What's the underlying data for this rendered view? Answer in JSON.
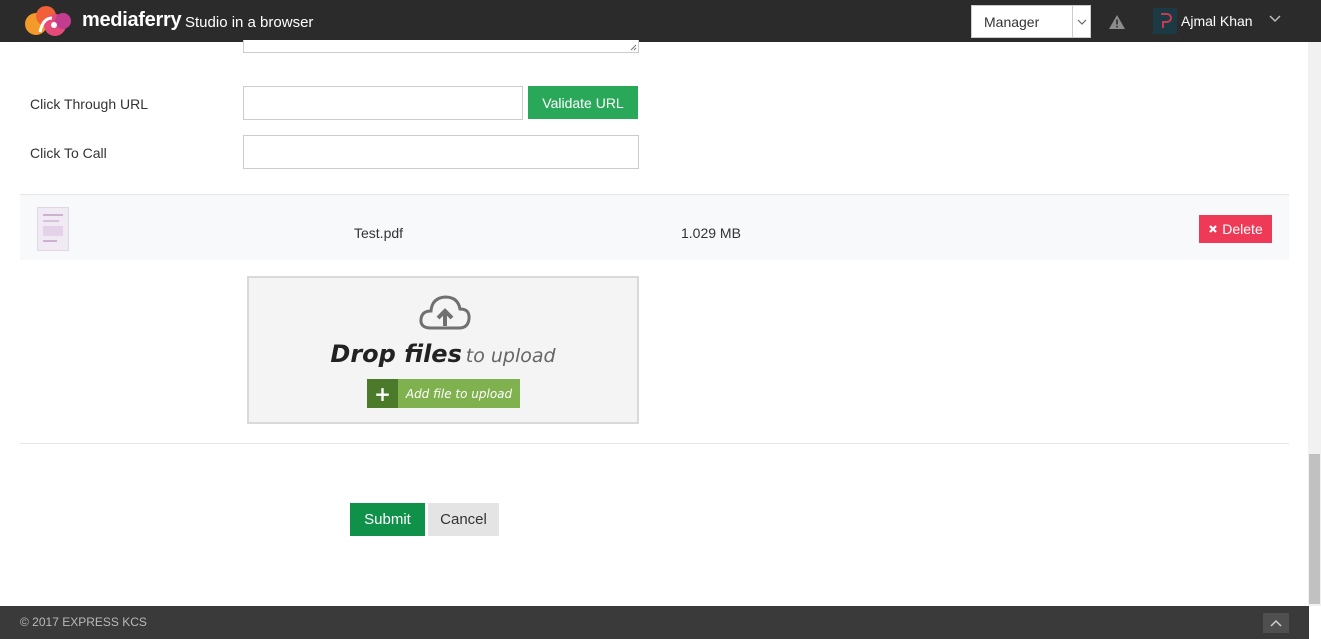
{
  "header": {
    "brand": "mediaferry",
    "tagline": "Studio in a browser",
    "role_selected": "Manager",
    "user_name": "Ajmal Khan",
    "icons": [
      "mediaferry-logo",
      "chevron-down-icon",
      "warning-icon",
      "user-avatar",
      "caret-down-icon"
    ]
  },
  "form": {
    "click_through_label": "Click Through URL",
    "click_through_value": "",
    "validate_label": "Validate URL",
    "click_to_call_label": "Click To Call",
    "click_to_call_value": ""
  },
  "file": {
    "name": "Test.pdf",
    "size": "1.029 MB",
    "delete_label": "Delete",
    "delete_icon": "close-icon"
  },
  "dropzone": {
    "title_bold": "Drop files",
    "title_light": "to upload",
    "add_label": "Add file to upload",
    "icon": "cloud-upload-icon"
  },
  "actions": {
    "submit_label": "Submit",
    "cancel_label": "Cancel"
  },
  "footer": {
    "copyright": "© 2017 EXPRESS KCS"
  },
  "colors": {
    "topbar": "#2b2b2b",
    "validate": "#2aa85a",
    "delete": "#ee3a57",
    "submit": "#10914a",
    "add_button": "#7fb24f"
  }
}
